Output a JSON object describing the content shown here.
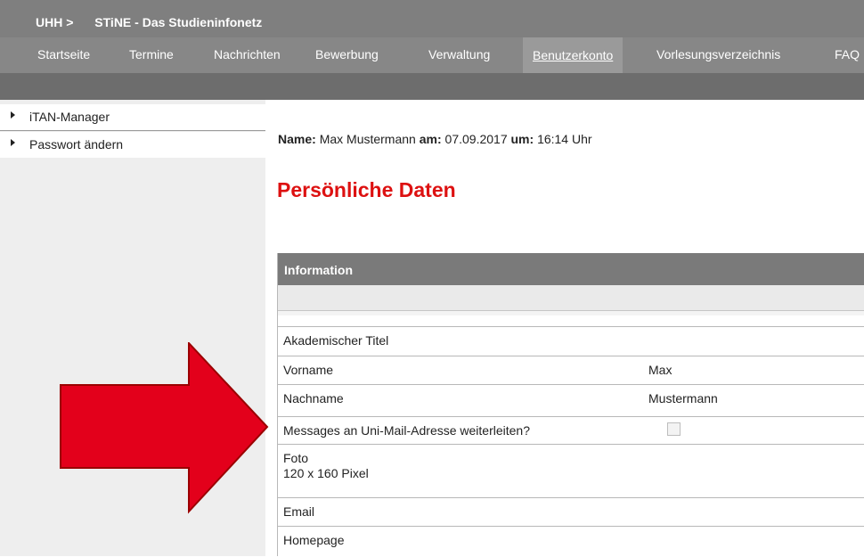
{
  "header": {
    "org": "UHH >",
    "app_title": "STiNE - Das Studieninfonetz"
  },
  "nav": {
    "items": [
      "Startseite",
      "Termine",
      "Nachrichten",
      "Bewerbung",
      "Verwaltung",
      "Benutzerkonto",
      "Vorlesungsverzeichnis",
      "FAQ"
    ],
    "active": "Benutzerkonto"
  },
  "sidebar": {
    "items": [
      {
        "label": "iTAN-Manager"
      },
      {
        "label": "Passwort ändern"
      }
    ]
  },
  "meta": {
    "name_label": "Name:",
    "name_value": "Max Mustermann",
    "date_label": "am:",
    "date_value": "07.09.2017",
    "time_label": "um:",
    "time_value": "16:14 Uhr"
  },
  "page": {
    "title": "Persönliche Daten"
  },
  "table": {
    "header": "Information",
    "rows": [
      {
        "key": "Akademischer Titel",
        "value": ""
      },
      {
        "key": "Vorname",
        "value": "Max"
      },
      {
        "key": "Nachname",
        "value": "Mustermann"
      },
      {
        "key": "Messages an Uni-Mail-Adresse weiterleiten?",
        "checkbox": false
      },
      {
        "key_line1": "Foto",
        "key_line2": "120 x 160 Pixel",
        "value": ""
      },
      {
        "key": "Email",
        "value": ""
      },
      {
        "key": "Homepage",
        "value": ""
      }
    ]
  },
  "colors": {
    "accent_red": "#dd1111",
    "arrow_red": "#e3001b",
    "nav_gray": "#878787"
  }
}
